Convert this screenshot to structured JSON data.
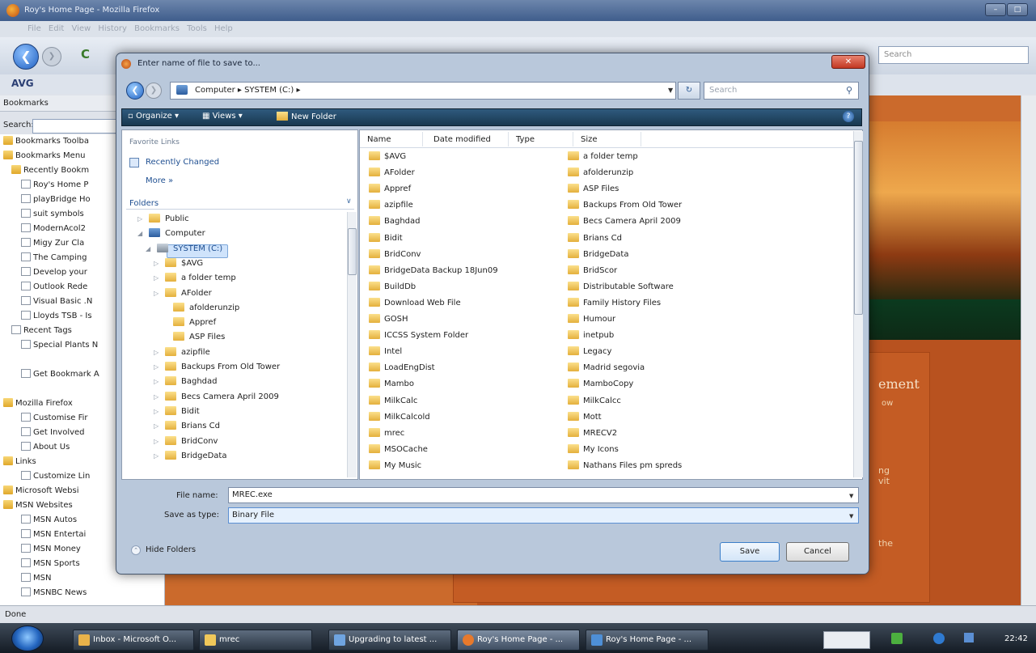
{
  "browser": {
    "title": "Roy's Home Page - Mozilla Firefox",
    "menu": "File  Edit  View  History  Bookmarks  Tools  Help",
    "search_placeholder": "Search",
    "toolbar_brand": "AVG",
    "bookmarks_header": "Bookmarks",
    "search_label": "Search:",
    "status": "Done",
    "content_text": {
      "heading_fragment": "ement",
      "line1": "ow",
      "line2": "ng",
      "line3": "vit",
      "line4": "the"
    }
  },
  "bookmarks": [
    "Bookmarks Toolba",
    "Bookmarks Menu",
    "Recently Bookm",
    "Roy's Home P",
    "playBridge Ho",
    "suit symbols",
    "ModernAcol2",
    "Migy Zur Cla",
    "The Camping",
    "Develop your",
    "Outlook Rede",
    "Visual Basic .N",
    "Lloyds TSB - Is",
    "Recent Tags",
    "Special Plants N",
    "Get Bookmark A",
    "Mozilla Firefox",
    "Customise Fir",
    "Get Involved",
    "About Us",
    "Links",
    "Customize Lin",
    "Microsoft Websi",
    "MSN Websites",
    "MSN Autos",
    "MSN Entertai",
    "MSN Money",
    "MSN Sports",
    "MSN",
    "MSNBC News"
  ],
  "dialog": {
    "title": "Enter name of file to save to...",
    "address": "Computer ▸ SYSTEM (C:) ▸",
    "search_placeholder": "Search",
    "toolbar": {
      "organize": "Organize ▾",
      "views": "Views ▾",
      "new_folder": "New Folder"
    },
    "favorite_links_label": "Favorite Links",
    "recently_changed": "Recently Changed",
    "more": "More »",
    "folders_label": "Folders",
    "tree": [
      "Public",
      "Computer",
      "SYSTEM (C:)",
      "$AVG",
      "a folder temp",
      "AFolder",
      "afolderunzip",
      "Appref",
      "ASP Files",
      "azipfile",
      "Backups From Old Tower",
      "Baghdad",
      "Becs Camera April 2009",
      "Bidit",
      "Brians Cd",
      "BridConv",
      "BridgeData"
    ],
    "columns": [
      "Name",
      "Date modified",
      "Type",
      "Size"
    ],
    "files_col1": [
      "$AVG",
      "AFolder",
      "Appref",
      "azipfile",
      "Baghdad",
      "Bidit",
      "BridConv",
      "BridgeData Backup 18Jun09",
      "BuildDb",
      "Download Web File",
      "GOSH",
      "ICCSS System Folder",
      "Intel",
      "LoadEngDist",
      "Mambo",
      "MilkCalc",
      "MilkCalcold",
      "mrec",
      "MSOCache",
      "My Music"
    ],
    "files_col2": [
      "a folder temp",
      "afolderunzip",
      "ASP Files",
      "Backups From Old Tower",
      "Becs Camera April 2009",
      "Brians Cd",
      "BridgeData",
      "BridScor",
      "Distributable Software",
      "Family History Files",
      "Humour",
      "inetpub",
      "Legacy",
      "Madrid segovia",
      "MamboCopy",
      "MilkCalcc",
      "Mott",
      "MRECV2",
      "My Icons",
      "Nathans Files pm spreds"
    ],
    "file_name_label": "File name:",
    "file_name_value": "MREC.exe",
    "save_type_label": "Save as type:",
    "save_type_value": "Binary File",
    "hide_folders": "Hide Folders",
    "save": "Save",
    "cancel": "Cancel"
  },
  "taskbar": {
    "items": [
      "Inbox - Microsoft O...",
      "mrec",
      "Upgrading to latest ...",
      "Roy's Home Page - ...",
      "Roy's Home Page - ..."
    ],
    "clock": "22:42"
  }
}
